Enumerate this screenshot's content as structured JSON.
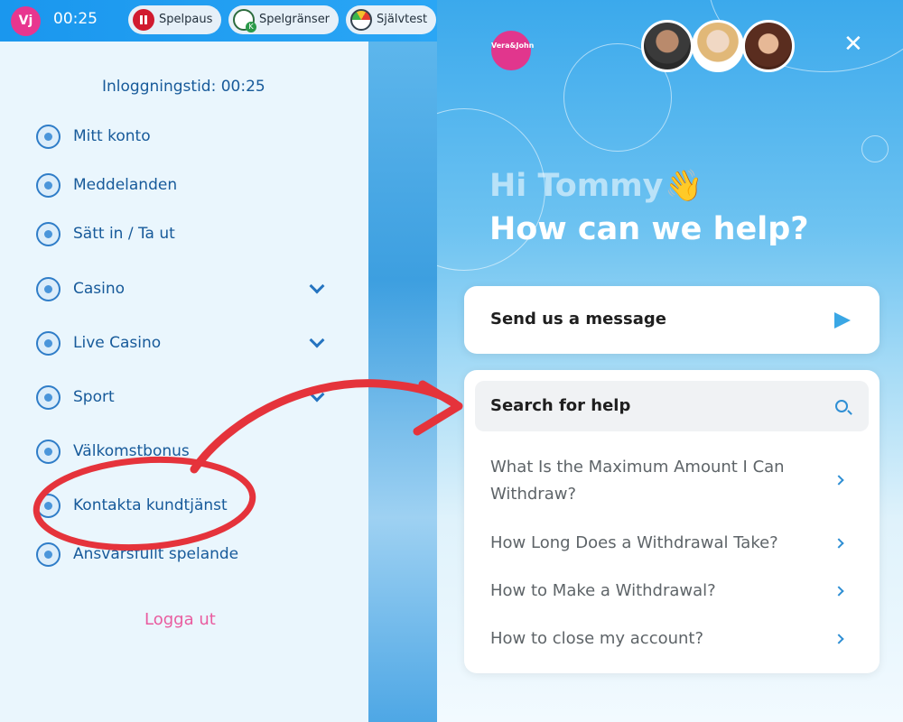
{
  "topbar": {
    "logo": "Vj",
    "timer": "00:25",
    "buttons": [
      {
        "label": "Spelpaus",
        "icon": "pause-icon"
      },
      {
        "label": "Spelgränser",
        "icon": "limit-icon"
      },
      {
        "label": "Självtest",
        "icon": "gauge-icon"
      }
    ]
  },
  "menu": {
    "login_time": "Inloggningstid: 00:25",
    "items": [
      {
        "label": "Mitt konto",
        "icon": "user-icon"
      },
      {
        "label": "Meddelanden",
        "icon": "mail-icon"
      },
      {
        "label": "Sätt in / Ta ut",
        "icon": "coins-icon"
      },
      {
        "label": "Casino",
        "icon": "cherry-icon",
        "expandable": true
      },
      {
        "label": "Live Casino",
        "icon": "spade-icon",
        "expandable": true
      },
      {
        "label": "Sport",
        "icon": "trophy-icon",
        "expandable": true
      },
      {
        "label": "Välkomstbonus",
        "icon": "gift-icon"
      },
      {
        "label": "Kontakta kundtjänst",
        "icon": "support-icon"
      },
      {
        "label": "Ansvarsfullt spelande",
        "icon": "handshake-icon"
      }
    ],
    "logout": "Logga ut"
  },
  "widget": {
    "brand": "Vera&John",
    "close": "✕",
    "greeting": "Hi Tommy",
    "wave_emoji": "👋",
    "headline": "How can we help?",
    "message_card": {
      "label": "Send us a message"
    },
    "search": {
      "label": "Search for help"
    },
    "articles": [
      "What Is the Maximum Amount I Can Withdraw?",
      "How Long Does a Withdrawal Take?",
      "How to Make a Withdrawal?",
      "How to close my account?"
    ]
  },
  "colors": {
    "annotation": "#e5333b",
    "accent": "#1d9bf0",
    "brand_pink": "#e1368d"
  }
}
